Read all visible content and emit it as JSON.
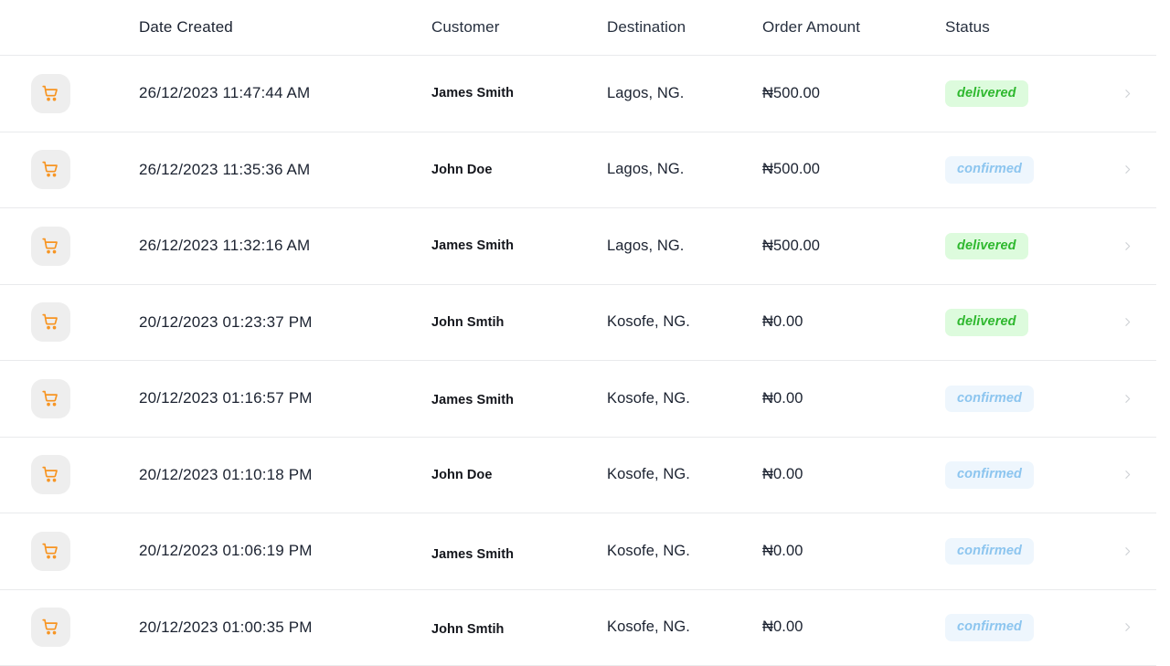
{
  "table": {
    "columns": {
      "icon": "",
      "date_created": "Date Created",
      "customer": "Customer",
      "destination": "Destination",
      "order_amount": "Order Amount",
      "status": "Status",
      "action": ""
    },
    "icons": {
      "row_icon": "shopping-cart-icon",
      "row_action_icon": "chevron-right-icon"
    },
    "colors": {
      "cart_icon": "#f79421",
      "cart_tile_bg": "#eeeeee",
      "delivered_text": "#2eb82e",
      "delivered_bg": "#ddfbdd",
      "confirmed_text": "#8cc5ef",
      "confirmed_bg": "#eef6fd",
      "divider": "#e9eaec",
      "text_primary": "#1b2230",
      "chevron": "#cfd2d6"
    },
    "rows": [
      {
        "date_created": "26/12/2023 11:47:44 AM",
        "customer": "James Smith",
        "destination": "Lagos, NG.",
        "order_amount": "₦500.00",
        "status": "delivered"
      },
      {
        "date_created": "26/12/2023 11:35:36 AM",
        "customer": "John Doe",
        "destination": "Lagos, NG.",
        "order_amount": "₦500.00",
        "status": "confirmed"
      },
      {
        "date_created": "26/12/2023 11:32:16 AM",
        "customer": "James Smith",
        "destination": "Lagos, NG.",
        "order_amount": "₦500.00",
        "status": "delivered"
      },
      {
        "date_created": "20/12/2023 01:23:37 PM",
        "customer": "John Smtih",
        "destination": "Kosofe, NG.",
        "order_amount": "₦0.00",
        "status": "delivered"
      },
      {
        "date_created": "20/12/2023 01:16:57 PM",
        "customer": "James Smith",
        "destination": "Kosofe, NG.",
        "order_amount": "₦0.00",
        "status": "confirmed"
      },
      {
        "date_created": "20/12/2023 01:10:18 PM",
        "customer": "John Doe",
        "destination": "Kosofe, NG.",
        "order_amount": "₦0.00",
        "status": "confirmed"
      },
      {
        "date_created": "20/12/2023 01:06:19 PM",
        "customer": "James Smith",
        "destination": "Kosofe, NG.",
        "order_amount": "₦0.00",
        "status": "confirmed"
      },
      {
        "date_created": "20/12/2023 01:00:35 PM",
        "customer": "John Smtih",
        "destination": "Kosofe, NG.",
        "order_amount": "₦0.00",
        "status": "confirmed"
      }
    ]
  }
}
